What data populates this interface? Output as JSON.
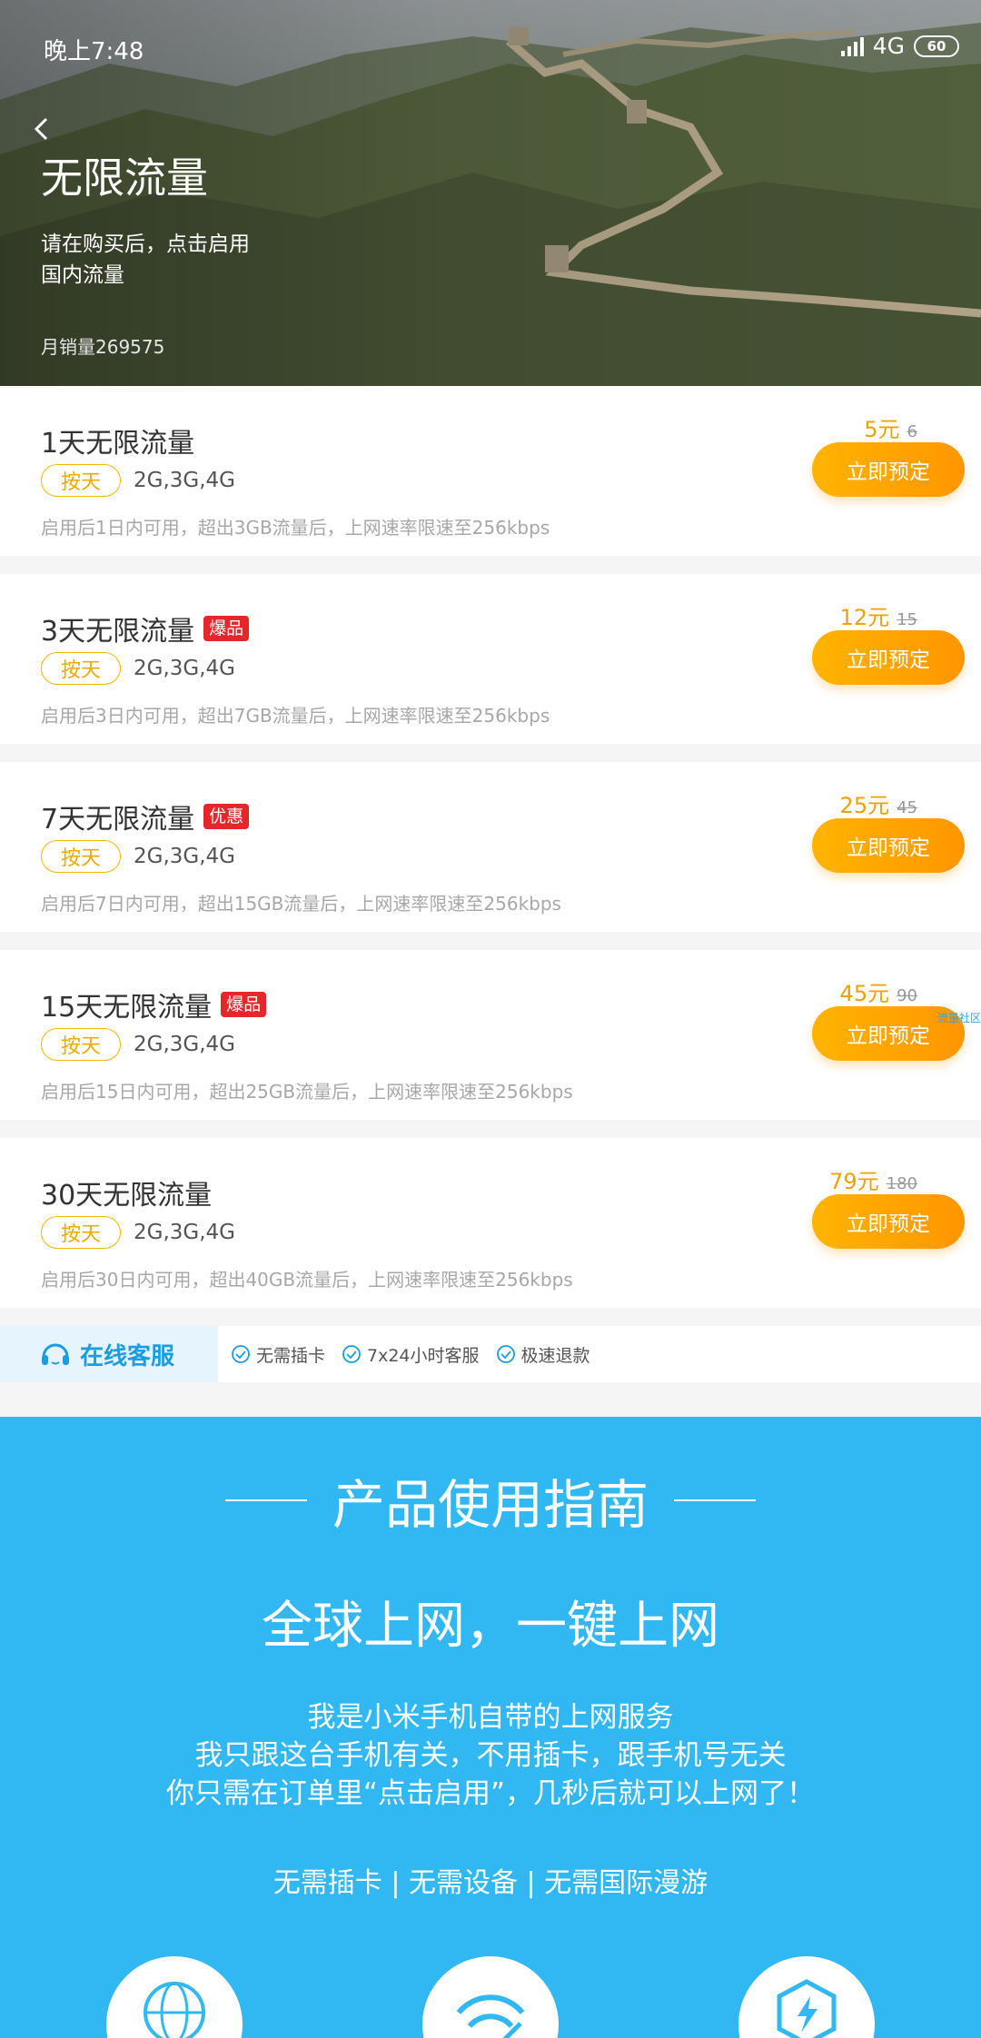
{
  "status_bar": {
    "time": "晚上7:48",
    "network": "4G",
    "battery": "60"
  },
  "hero": {
    "title": "无限流量",
    "subtitle_line1": "请在购买后，点击启用",
    "subtitle_line2": "国内流量",
    "sales": "月销量269575"
  },
  "plans": [
    {
      "title": "1天无限流量",
      "badge": "",
      "tag": "按天",
      "network": "2G,3G,4G",
      "desc": "启用后1日内可用，超出3GB流量后，上网速率限速至256kbps",
      "price": "5元",
      "old_price": "6",
      "button": "立即预定"
    },
    {
      "title": "3天无限流量",
      "badge": "爆品",
      "tag": "按天",
      "network": "2G,3G,4G",
      "desc": "启用后3日内可用，超出7GB流量后，上网速率限速至256kbps",
      "price": "12元",
      "old_price": "15",
      "button": "立即预定"
    },
    {
      "title": "7天无限流量",
      "badge": "优惠",
      "tag": "按天",
      "network": "2G,3G,4G",
      "desc": "启用后7日内可用，超出15GB流量后，上网速率限速至256kbps",
      "price": "25元",
      "old_price": "45",
      "button": "立即预定"
    },
    {
      "title": "15天无限流量",
      "badge": "爆品",
      "tag": "按天",
      "network": "2G,3G,4G",
      "desc": "启用后15日内可用，超出25GB流量后，上网速率限速至256kbps",
      "price": "45元",
      "old_price": "90",
      "button": "立即预定"
    },
    {
      "title": "30天无限流量",
      "badge": "",
      "tag": "按天",
      "network": "2G,3G,4G",
      "desc": "启用后30日内可用，超出40GB流量后，上网速率限速至256kbps",
      "price": "79元",
      "old_price": "180",
      "button": "立即预定"
    }
  ],
  "float_link": "流量社区",
  "service": {
    "label": "在线客服",
    "items": [
      "无需插卡",
      "7x24小时客服",
      "极速退款"
    ]
  },
  "guide": {
    "heading": "产品使用指南",
    "tagline": "全球上网，一键上网",
    "intro_line1": "我是小米手机自带的上网服务",
    "intro_line2": "我只跟这台手机有关，不用插卡，跟手机号无关",
    "intro_line3": "你只需在订单里“点击启用”，几秒后就可以上网了！",
    "features": "无需插卡 | 无需设备 | 无需国际漫游",
    "icons": [
      "globe-icon",
      "wifi-icon",
      "lightning-shield-icon"
    ]
  },
  "colors": {
    "accent_orange": "#ff9f00",
    "badge_red": "#e5262a",
    "guide_blue": "#31b8f2",
    "service_blue": "#1c9de2"
  }
}
